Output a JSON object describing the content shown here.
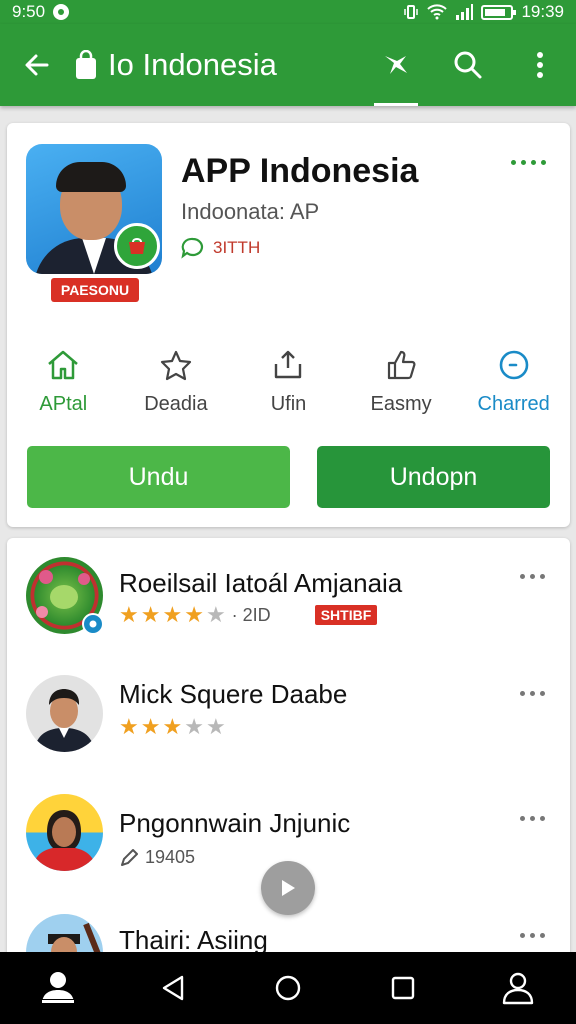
{
  "status_bar": {
    "time": "9:50",
    "clock_right": "19:39",
    "battery_level": 0.8
  },
  "app_bar": {
    "title": "Io Indonesia",
    "icons": [
      "back-arrow-icon",
      "shopping-bag-icon",
      "pin-icon",
      "search-icon",
      "overflow-menu-icon"
    ]
  },
  "app_card": {
    "name": "APP Indonesia",
    "publisher": "Indoonata: AP",
    "meta": "3ITTH",
    "tag": "PAESONU",
    "actions": [
      {
        "label": "APtal",
        "icon": "home-icon",
        "color": "#2e9a38"
      },
      {
        "label": "Deadia",
        "icon": "star-icon",
        "color": "#444444"
      },
      {
        "label": "Ufin",
        "icon": "share-icon",
        "color": "#444444"
      },
      {
        "label": "Easmy",
        "icon": "thumb-up-icon",
        "color": "#444444"
      },
      {
        "label": "Charred",
        "icon": "clock-icon",
        "color": "#1a8bc7"
      }
    ],
    "primary_button": "Undu",
    "secondary_button": "Undopn"
  },
  "list": {
    "items": [
      {
        "title": "Roeilsail Iatoál Amjanaia",
        "rating": 4,
        "meta": "· 2ID",
        "tag": "SHTIBF"
      },
      {
        "title": "Mick Squere Daabe",
        "rating": 3,
        "meta": "",
        "tag": ""
      },
      {
        "title": "Pngonnwain Jnjunic",
        "rating": null,
        "meta": "19405",
        "tag": ""
      },
      {
        "title": "Thairi: Asiing",
        "rating": null,
        "meta": "",
        "tag": ""
      }
    ]
  },
  "colors": {
    "primary": "#2e9a38",
    "button_light": "#4cb748",
    "button_dark": "#27953a",
    "star": "#f0a020",
    "star_empty": "#b8b8b8",
    "tag_red": "#d93025"
  }
}
